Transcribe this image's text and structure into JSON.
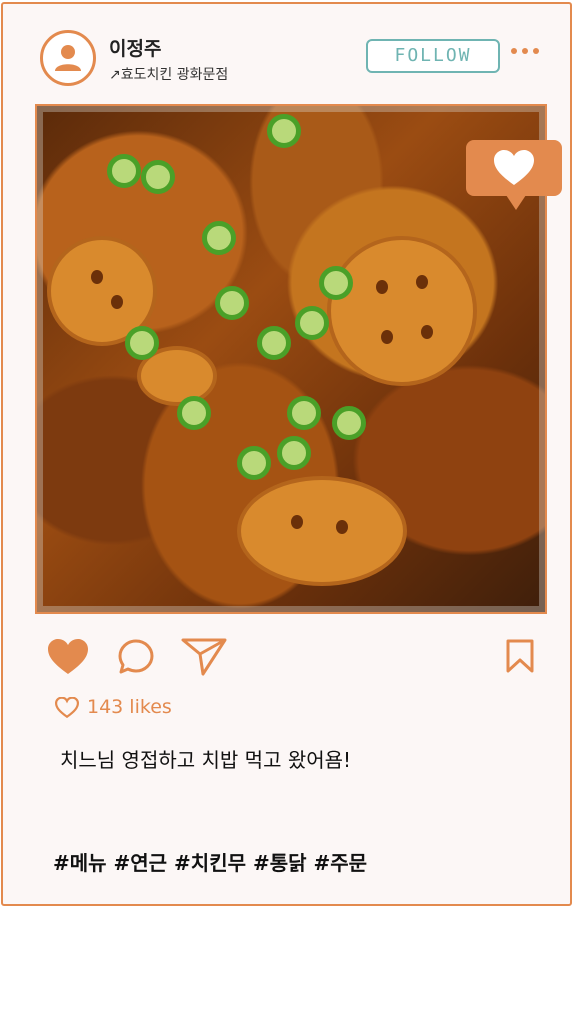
{
  "post": {
    "username": "이정주",
    "location": "↗효도치킨 광화문점",
    "follow_label": "FOLLOW",
    "likes_text": "143 likes",
    "caption": "치느님 영접하고 치밥 먹고 왔어욤!",
    "hashtags": "#메뉴 #연근 #치킨무 #통닭 #주문"
  },
  "icons": {
    "avatar": "user-icon",
    "more": "more-dots-icon",
    "like_badge": "heart-badge-icon",
    "like": "heart-icon",
    "comment": "comment-icon",
    "share": "send-icon",
    "save": "bookmark-icon"
  },
  "colors": {
    "accent": "#e38a4e",
    "follow": "#6fb4b2",
    "card_bg": "#fcf7f6"
  }
}
